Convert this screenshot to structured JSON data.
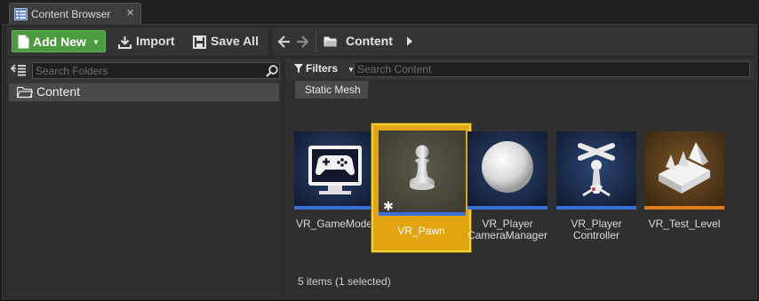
{
  "tab": {
    "title": "Content Browser",
    "close": "✕"
  },
  "toolbar": {
    "add_new": "Add New",
    "import": "Import",
    "save_all": "Save All"
  },
  "breadcrumb": {
    "label": "Content"
  },
  "folders": {
    "search_placeholder": "Search Folders",
    "tree": [
      {
        "label": "Content",
        "selected": true
      }
    ]
  },
  "assets": {
    "filters_label": "Filters",
    "search_placeholder": "Search Content",
    "active_filter": "Static Mesh",
    "tiles": [
      {
        "name": "VR_GameMode",
        "icon": "gamepad-monitor-icon",
        "stripe": "#3a6fd8"
      },
      {
        "name": "VR_Pawn",
        "icon": "pawn-icon",
        "stripe": "#3a6fd8",
        "selected": true
      },
      {
        "name_line1": "VR_Player",
        "name_line2": "CameraManager",
        "icon": "sphere-icon",
        "stripe": "#3a6fd8"
      },
      {
        "name_line1": "VR_Player",
        "name_line2": "Controller",
        "icon": "player-controller-icon",
        "stripe": "#3a6fd8"
      },
      {
        "name": "VR_Test_Level",
        "icon": "level-icon",
        "stripe": "#e07a1a"
      }
    ],
    "status": "5 items (1 selected)"
  },
  "colors": {
    "add_button": "#4d9b41",
    "selection": "#e2a410",
    "blueprint_tile": "#1d2f52",
    "level_tile": "#6b4a1c"
  }
}
